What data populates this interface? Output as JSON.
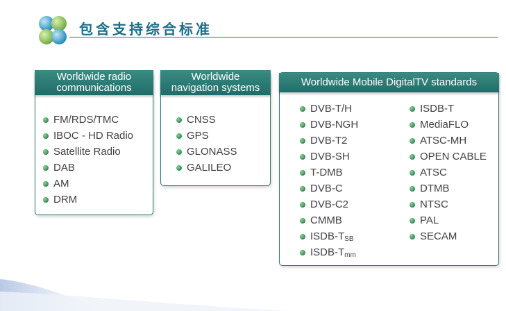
{
  "header": {
    "title": "包含支持综合标准",
    "logo_icon": "four-circles-logo-icon"
  },
  "colors": {
    "accent": "#1a6f86",
    "card_header": "#2b7b74",
    "bullet": "#3b9a5a"
  },
  "cards": [
    {
      "title_line1": "Worldwide radio",
      "title_line2": "communications",
      "items": [
        "FM/RDS/TMC",
        "IBOC - HD Radio",
        "Satellite Radio",
        "DAB",
        "AM",
        "DRM"
      ]
    },
    {
      "title_line1": "Worldwide",
      "title_line2": "navigation systems",
      "items": [
        "CNSS",
        "GPS",
        "GLONASS",
        "GALILEO"
      ]
    },
    {
      "title_line1": "Worldwide Mobile DigitalTV standards",
      "col1": [
        "DVB-T/H",
        "DVB-NGH",
        "DVB-T2",
        "DVB-SH",
        "T-DMB",
        "DVB-C",
        "DVB-C2",
        "CMMB"
      ],
      "col1_extra": [
        {
          "main": "ISDB-T",
          "sub": "SB"
        },
        {
          "main": "ISDB-T",
          "sub": "mm"
        }
      ],
      "col2": [
        "ISDB-T",
        "MediaFLO",
        "ATSC-MH",
        "OPEN CABLE",
        "ATSC",
        "DTMB",
        "NTSC",
        "PAL",
        "SECAM"
      ]
    }
  ]
}
